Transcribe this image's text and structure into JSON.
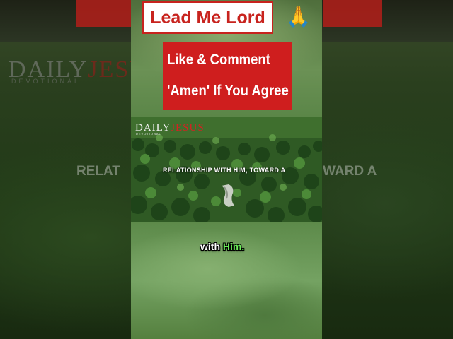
{
  "header": {
    "title_button": "Lead Me Lord",
    "emoji": "🙏"
  },
  "cta": {
    "line1": "Like & Comment",
    "line2": "'Amen' If You Agree"
  },
  "video": {
    "logo_main": "DAILY",
    "logo_accent": "JESUS",
    "logo_sub": "DEVOTIONAL",
    "caption": "RELATIONSHIP WITH HIM, TOWARD A"
  },
  "subtitle": {
    "word1": "with",
    "word2": "Him."
  },
  "background": {
    "logo_main": "DAILY",
    "logo_accent": "JESUS",
    "logo_sub": "DEVOTIONAL",
    "caption_left": "RELAT",
    "caption_right": "WARD A"
  },
  "colors": {
    "brand_red": "#cf1e1e",
    "highlight_green": "#6cf05a"
  }
}
